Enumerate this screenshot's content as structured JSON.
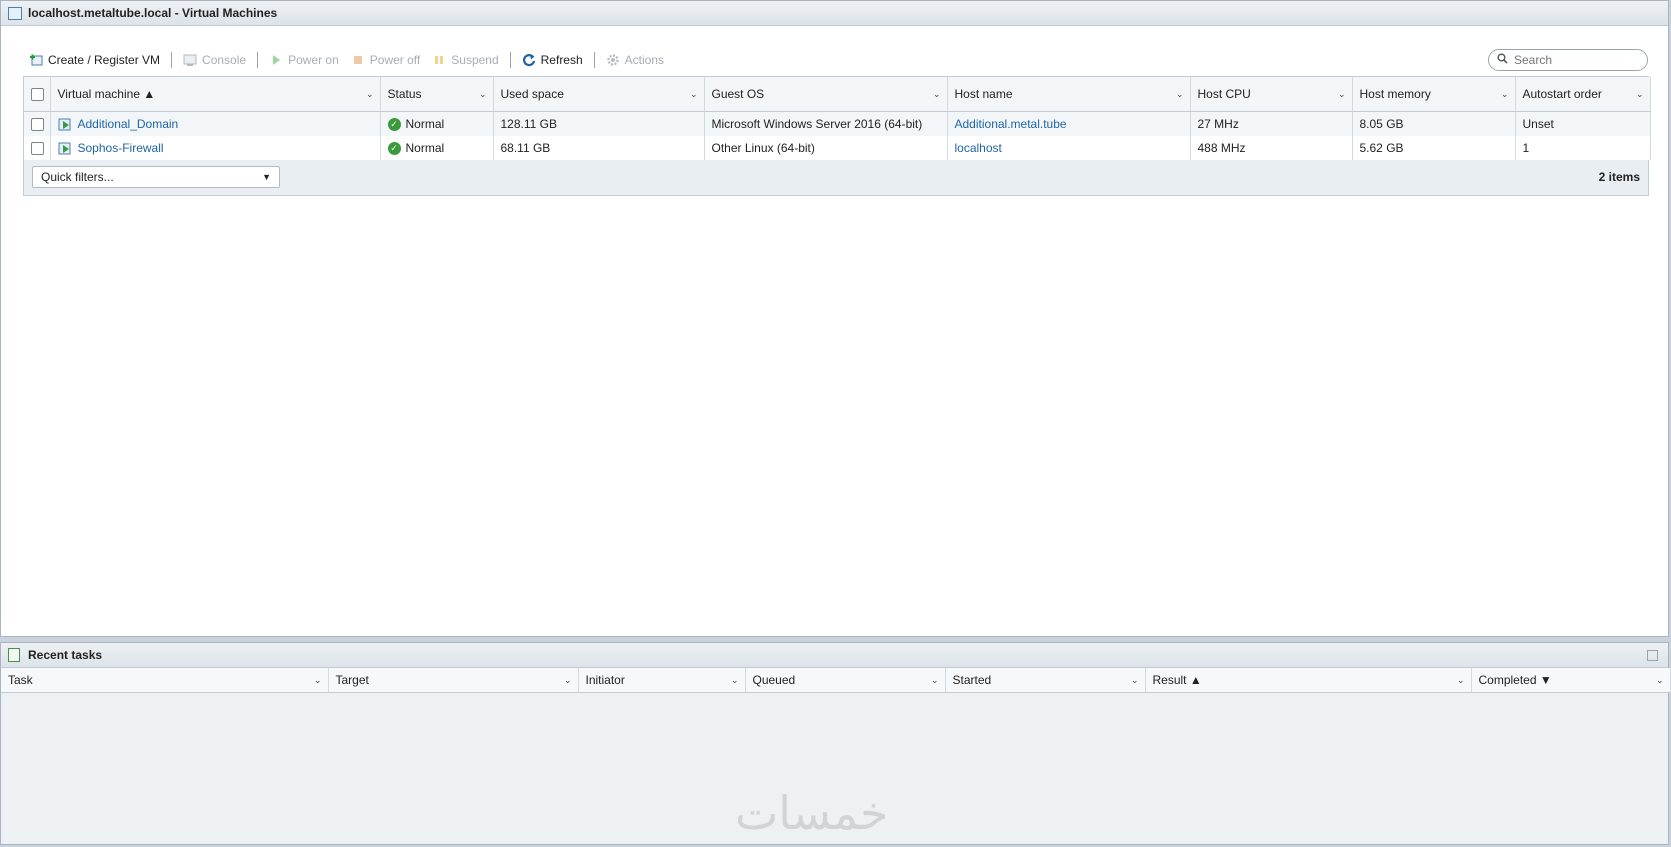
{
  "window": {
    "title": "localhost.metaltube.local - Virtual Machines"
  },
  "toolbar": {
    "create": "Create / Register VM",
    "console": "Console",
    "power_on": "Power on",
    "power_off": "Power off",
    "suspend": "Suspend",
    "refresh": "Refresh",
    "actions": "Actions"
  },
  "search": {
    "placeholder": "Search"
  },
  "vm_table": {
    "columns": [
      "Virtual machine ▲",
      "Status",
      "Used space",
      "Guest OS",
      "Host name",
      "Host CPU",
      "Host memory",
      "Autostart order"
    ],
    "rows": [
      {
        "name": "Additional_Domain",
        "status": "Normal",
        "used": "128.11 GB",
        "os": "Microsoft Windows Server 2016 (64-bit)",
        "host": "Additional.metal.tube",
        "cpu": "27 MHz",
        "mem": "8.05 GB",
        "autostart": "Unset"
      },
      {
        "name": "Sophos-Firewall",
        "status": "Normal",
        "used": "68.11 GB",
        "os": "Other Linux (64-bit)",
        "host": "localhost",
        "cpu": "488 MHz",
        "mem": "5.62 GB",
        "autostart": "1"
      }
    ],
    "quick_filters": "Quick filters...",
    "item_count": "2 items"
  },
  "tasks": {
    "title": "Recent tasks",
    "columns": [
      "Task",
      "Target",
      "Initiator",
      "Queued",
      "Started",
      "Result ▲",
      "Completed ▼"
    ]
  },
  "watermark": "خمسات",
  "colors": {
    "link": "#1f64a6",
    "status_ok": "#3a9b3a",
    "header_bg": "#dde3e9"
  }
}
